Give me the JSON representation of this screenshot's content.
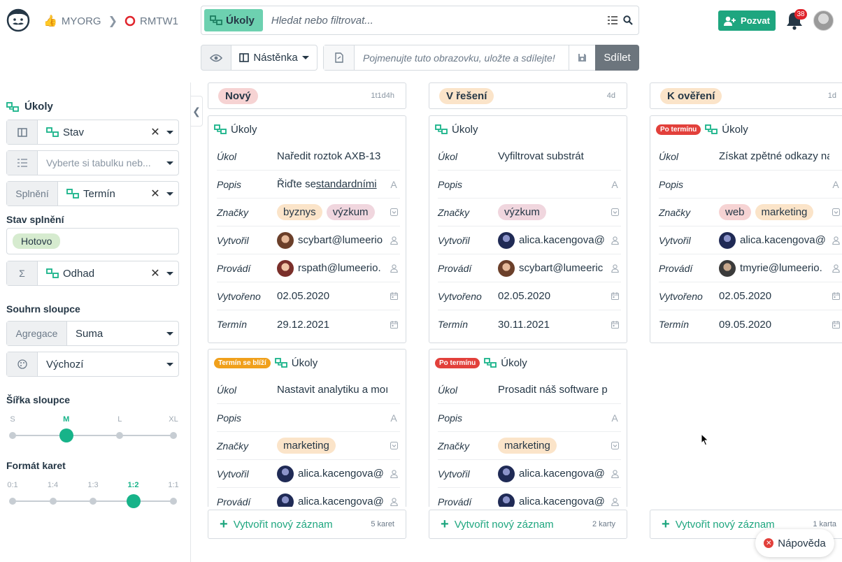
{
  "breadcrumb": {
    "org": "MYORG",
    "project": "RMTW1"
  },
  "search": {
    "table_chip": "Úkoly",
    "placeholder": "Hledat nebo filtrovat..."
  },
  "header": {
    "invite_label": "Pozvat",
    "notification_count": "38"
  },
  "toolbar": {
    "view_type": "Nástěnka",
    "view_name_placeholder": "Pojmenujte tuto obrazovku, uložte a sdílejte!",
    "share_label": "Sdílet"
  },
  "sidebar": {
    "table_title": "Úkoly",
    "group_by": "Stav",
    "sort_placeholder": "Vyberte si tabulku neb...",
    "completion_prefix": "Splnění",
    "completion_value": "Termín",
    "completion_state_label": "Stav splnění",
    "completion_state_value": "Hotovo",
    "sum_prefix": "Σ",
    "sum_value": "Odhad",
    "summary_label": "Souhrn sloupce",
    "aggregation_prefix": "Agregace",
    "aggregation_value": "Suma",
    "color_value": "Výchozí",
    "width_label": "Šířka sloupce",
    "width_options": [
      "S",
      "M",
      "L",
      "XL"
    ],
    "width_selected": 1,
    "format_label": "Formát karet",
    "format_options": [
      "0:1",
      "1:4",
      "1:3",
      "1:2",
      "1:1"
    ],
    "format_selected": 3
  },
  "columns": [
    {
      "status": "Nový",
      "status_color": "#f6d3d3",
      "age": "1t1d4h",
      "footer": "Vytvořit nový záznam",
      "count": "5 karet",
      "cards": [
        {
          "flag": "",
          "flag_color": "",
          "table": "Úkoly",
          "fields": {
            "task": "Naředit roztok AXB-13",
            "desc": "Řiďte se ",
            "desc_link": "standardními",
            "tags": [
              [
                "byznys",
                "orange"
              ],
              [
                "výzkum",
                "pink"
              ]
            ],
            "creator": "scybart@lumeerio",
            "creator_ava": "a1",
            "assignee": "rspath@lumeerio.",
            "assignee_ava": "a2",
            "created": "02.05.2020",
            "due": "29.12.2021"
          }
        },
        {
          "flag": "Termín se blíží",
          "flag_color": "orange",
          "table": "Úkoly",
          "fields": {
            "task": "Nastavit analytiku a moı",
            "desc": "",
            "desc_link": "",
            "tags": [
              [
                "marketing",
                "orange"
              ]
            ],
            "creator": "alica.kacengova@",
            "creator_ava": "a3",
            "assignee": "alica.kacengova@",
            "assignee_ava": "a3",
            "created": "",
            "due": ""
          }
        }
      ]
    },
    {
      "status": "V řešení",
      "status_color": "#fbe4c9",
      "age": "4d",
      "footer": "Vytvořit nový záznam",
      "count": "2 karty",
      "cards": [
        {
          "flag": "",
          "flag_color": "",
          "table": "Úkoly",
          "fields": {
            "task": "Vyfiltrovat substrát",
            "desc": "",
            "desc_link": "",
            "tags": [
              [
                "výzkum",
                "pink"
              ]
            ],
            "creator": "alica.kacengova@",
            "creator_ava": "a3",
            "assignee": "scybart@lumeeric",
            "assignee_ava": "a1",
            "created": "02.05.2020",
            "due": "30.11.2021"
          }
        },
        {
          "flag": "Po termínu",
          "flag_color": "red",
          "table": "Úkoly",
          "fields": {
            "task": "Prosadit náš software pı",
            "desc": "",
            "desc_link": "",
            "tags": [
              [
                "marketing",
                "orange"
              ]
            ],
            "creator": "alica.kacengova@",
            "creator_ava": "a3",
            "assignee": "alica.kacengova@",
            "assignee_ava": "a3",
            "created": "",
            "due": ""
          }
        }
      ]
    },
    {
      "status": "K ověření",
      "status_color": "#fbe4c9",
      "age": "1d",
      "footer": "Vytvořit nový záznam",
      "count": "1 karta",
      "cards": [
        {
          "flag": "Po termínu",
          "flag_color": "red",
          "table": "Úkoly",
          "fields": {
            "task": "Získat zpětné odkazy na",
            "desc": "",
            "desc_link": "",
            "tags": [
              [
                "web",
                "red"
              ],
              [
                "marketing",
                "orange"
              ]
            ],
            "creator": "alica.kacengova@",
            "creator_ava": "a3",
            "assignee": "tmyrie@lumeerio.",
            "assignee_ava": "a4",
            "created": "02.05.2020",
            "due": "09.05.2020"
          }
        }
      ]
    }
  ],
  "field_labels": {
    "task": "Úkol",
    "desc": "Popis",
    "tags": "Značky",
    "creator": "Vytvořil",
    "assignee": "Provádí",
    "created": "Vytvořeno",
    "due": "Termín"
  },
  "help_label": "Nápověda",
  "colors": {
    "accent": "#1ea67f",
    "notification": "#e0242c",
    "overdue": "#e2403b",
    "due_soon": "#f0a01b"
  }
}
